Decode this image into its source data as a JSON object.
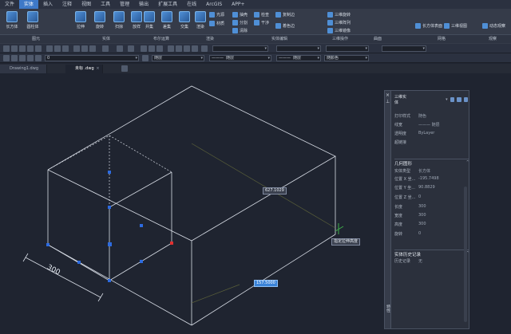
{
  "menu": [
    "文件",
    "实体",
    "插入",
    "注释",
    "视图",
    "工具",
    "管理",
    "输出",
    "扩展工具",
    "在线",
    "ArcGIS",
    "APP+"
  ],
  "menu_active": 1,
  "ribbon": {
    "tools": [
      "长方体",
      "圆柱体",
      "拉伸",
      "旋转",
      "扫掠",
      "放样",
      "并集",
      "差集",
      "交集",
      "渲染"
    ],
    "small_tools": [
      "光源",
      "材质",
      "抽壳",
      "分割",
      "清除",
      "剖切",
      "检查",
      "干涉",
      "复制边",
      "着色边",
      "三维旋转",
      "三维阵列",
      "三维镜像",
      "长方体表面",
      "三维视图",
      "动态观察"
    ],
    "groups": [
      "图元",
      "实体",
      "布尔运算",
      "渲染",
      "实体编辑",
      "三维操作",
      "曲面",
      "网格",
      "观察"
    ]
  },
  "toolbar": {
    "layer_value": "0",
    "linetype1": "随层",
    "linetype2": "随层",
    "lineweight": "随层",
    "color": "随颜色"
  },
  "tabs": [
    {
      "label": "Drawing1.dwg",
      "active": false
    },
    {
      "label": "未标 .dwg",
      "active": true
    }
  ],
  "viewport": {
    "dimension_text": "300",
    "annotation_dim1": "627.1029",
    "annotation_tooltip": "指定拉伸高度",
    "annotation_input": "157.5000"
  },
  "properties_panel": {
    "vertical_title": "特性",
    "object_type": "三维实体",
    "general": [
      {
        "key": "打印样式",
        "value": "随色"
      },
      {
        "key": "线宽",
        "value": "——— 随层"
      },
      {
        "key": "透明度",
        "value": "ByLayer"
      },
      {
        "key": "超链接",
        "value": ""
      }
    ],
    "geometry_section": "几何图形",
    "geometry": [
      {
        "key": "实体类型",
        "value": "长方体"
      },
      {
        "key": "位置 X 坐...",
        "value": "-195.7498"
      },
      {
        "key": "位置 Y 坐...",
        "value": "90.8829"
      },
      {
        "key": "位置 Z 坐...",
        "value": "0"
      },
      {
        "key": "长度",
        "value": "300"
      },
      {
        "key": "宽度",
        "value": "300"
      },
      {
        "key": "高度",
        "value": "300"
      },
      {
        "key": "旋转",
        "value": "0"
      }
    ],
    "history_section": "实体历史记录",
    "history": [
      {
        "key": "历史记录",
        "value": "无"
      }
    ]
  }
}
